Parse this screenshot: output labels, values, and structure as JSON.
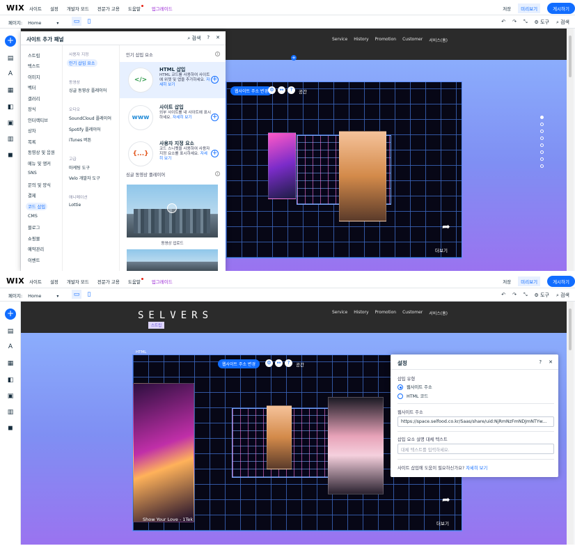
{
  "topbar": {
    "logo": "WIX",
    "menu": [
      "사이트",
      "설정",
      "개발자 모드",
      "전문가 고용",
      "도움말",
      "업그레이드"
    ],
    "save": "저장",
    "preview": "미리보기",
    "publish": "게시하기"
  },
  "toolbar": {
    "page_label": "페이지:",
    "page_value": "Home",
    "tools": "도구",
    "search": "검색"
  },
  "site": {
    "brand": "SELVERS",
    "nav": [
      "Service",
      "History",
      "Promotion",
      "Customer",
      "서비스(홈)"
    ]
  },
  "panel": {
    "title": "사이트 추가 패널",
    "search": "검색",
    "categories": [
      "스트립",
      "텍스트",
      "이미지",
      "벡터",
      "갤러리",
      "장식",
      "인터랙티브",
      "상자",
      "목록",
      "동영상 및 음원",
      "메뉴 및 앵커",
      "SNS",
      "문의 및 양식",
      "결제",
      "코드 삽입",
      "CMS",
      "블로그",
      "쇼핑몰",
      "예약관리",
      "이벤트"
    ],
    "sub": [
      {
        "h": "사용자 지정",
        "items": [
          "인기 삽입 요소"
        ]
      },
      {
        "h": "동영상",
        "items": [
          "싱글 동영상 플레이어"
        ]
      },
      {
        "h": "오디오",
        "items": [
          "SoundCloud 플레이어",
          "Spotify 플레이어",
          "iTunes 버튼"
        ]
      },
      {
        "h": "고급",
        "items": [
          "마케팅 도구",
          "Velo 개발자 도구"
        ]
      },
      {
        "h": "애니메이션",
        "items": [
          "Lottie"
        ]
      }
    ],
    "section1": "인기 삽입 요소",
    "cards": [
      {
        "icon": "</>",
        "title": "HTML 삽입",
        "desc": "HTML 코드를 사용하여 사이트에 위젯 및 앱을 추가하세요.",
        "link": "자세히 보기"
      },
      {
        "icon": "www",
        "title": "사이트 삽입",
        "desc": "외부 사이트를 내 사이트에 표시하세요.",
        "link": "자세히 보기"
      },
      {
        "icon": "{...}",
        "title": "사용자 지정 요소",
        "desc": "코드 스니펫을 사용하여 사용자 지정 요소를 표시하세요.",
        "link": "자세히 보기"
      }
    ],
    "section2": "싱글 동영상 플레이어",
    "thumb_caption": "동영상 업로드"
  },
  "stage": {
    "chip": "웹사이트 주소 변경",
    "space": "공간",
    "share_text": "더보기",
    "song": "Show Your Love - 1Tek",
    "strip_tag": "스트립",
    "html_tag": "HTML"
  },
  "settings": {
    "title": "설정",
    "insert_type": "삽입 유형",
    "opt1": "웹사이트 주소",
    "opt2": "HTML 코드",
    "url_label": "웹사이트 주소",
    "url_value": "https://space.selfood.co.kr/Saas/share/uid:NjRmNzFmNDJmNTYw...",
    "alt_label": "삽입 요소 설명 대체 텍스트",
    "alt_placeholder": "대체 텍스트를 입력하세요.",
    "help": "사이트 삽입에 도움이 필요하신가요?",
    "help_link": "자세히 보기"
  }
}
